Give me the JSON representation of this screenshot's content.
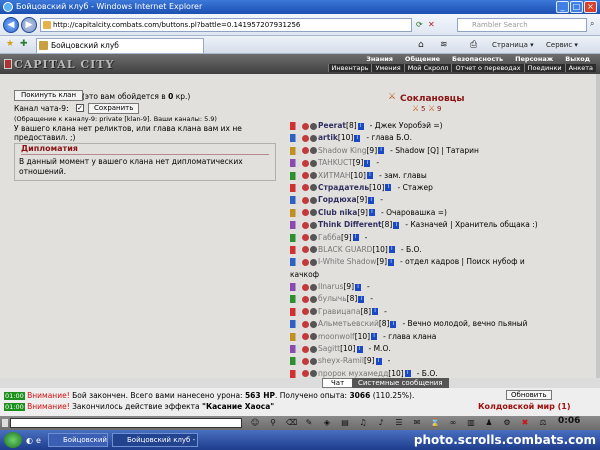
{
  "window": {
    "title": "Бойцовский клуб - Windows Internet Explorer"
  },
  "addressbar": {
    "url": "http://capitalcity.combats.com/buttons.pl?battle=0.141957207931256",
    "search_placeholder": "Rambler Search"
  },
  "tabbar": {
    "tab_title": "Бойцовский клуб",
    "page_label": "Страница",
    "service_label": "Сервис"
  },
  "game": {
    "logo": "CAPITAL CITY",
    "main_nav": [
      "Знания",
      "Общение",
      "Безопасность",
      "Персонаж",
      "Выход"
    ],
    "sub_nav": [
      "Инвентарь",
      "Умения",
      "Мой Скролл",
      "Отчет о переводах",
      "Поединки",
      "Анкета"
    ]
  },
  "clan": {
    "leave_button": "Покинуть клан",
    "leave_note_pre": "(это вам обойдется в ",
    "leave_note_amount": "0",
    "leave_note_post": " кр.)",
    "chat_channel_label": "Канал чата-9:",
    "save_button": "Сохранить",
    "channel_hint": "(Обращение к каналу-9: private [klan-9]. Ваши каналы: 5.9)",
    "relics_line1": "У вашего клана нет реликтов, или глава клана вам их не",
    "relics_line2": "предоставил. ;)",
    "diplomacy_title": "Дипломатия",
    "diplomacy_text": "В данный момент у вашего клана нет дипломатических отношений.",
    "allies_title": "Соклановцы",
    "online_count": "5",
    "total_count": "9"
  },
  "members": [
    {
      "name": "Peerat",
      "level": "[8]",
      "bold": true,
      "grey": false,
      "desc": "- Джек Уоробэй =)"
    },
    {
      "name": "artik",
      "level": "[10]",
      "bold": true,
      "grey": false,
      "desc": "- глава Б.О."
    },
    {
      "name": "Shadow King",
      "level": "[9]",
      "bold": false,
      "grey": true,
      "desc": "- Shadow [Q] | Татарин"
    },
    {
      "name": "TAHKUCT",
      "level": "[9]",
      "bold": false,
      "grey": true,
      "desc": "-"
    },
    {
      "name": "ХИТМАН",
      "level": "[10]",
      "bold": false,
      "grey": true,
      "desc": "- зам. главы"
    },
    {
      "name": "Страдатель",
      "level": "[10]",
      "bold": true,
      "grey": false,
      "desc": "- Стажер"
    },
    {
      "name": "Гордюха",
      "level": "[9]",
      "bold": true,
      "grey": false,
      "desc": "-"
    },
    {
      "name": "Club nika",
      "level": "[9]",
      "bold": true,
      "grey": false,
      "desc": "- Очаровашка =)"
    },
    {
      "name": "Think Different",
      "level": "[8]",
      "bold": true,
      "grey": false,
      "desc": "- Казначей | Хранитель общака :)"
    },
    {
      "name": "Габба",
      "level": "[9]",
      "bold": false,
      "grey": true,
      "desc": "-"
    },
    {
      "name": "BLACK GUARD",
      "level": "[10]",
      "bold": false,
      "grey": true,
      "desc": "- Б.О."
    },
    {
      "name": "I-White Shadow",
      "level": "[9]",
      "bold": false,
      "grey": true,
      "desc": "- отдел кадров | Поиск нубоф и"
    },
    {
      "name": "",
      "level": "",
      "bold": false,
      "grey": false,
      "desc": "качкоф"
    },
    {
      "name": "Ilnarus",
      "level": "[9]",
      "bold": false,
      "grey": true,
      "desc": "-"
    },
    {
      "name": "булычь",
      "level": "[8]",
      "bold": false,
      "grey": true,
      "desc": "-"
    },
    {
      "name": "Гравицапа",
      "level": "[8]",
      "bold": false,
      "grey": true,
      "desc": "-"
    },
    {
      "name": "Альметьевский",
      "level": "[8]",
      "bold": false,
      "grey": true,
      "desc": "- Вечно молодой, вечно пьяный"
    },
    {
      "name": "moonwolf",
      "level": "[10]",
      "bold": false,
      "grey": true,
      "desc": "- глава клана"
    },
    {
      "name": "Sagitt",
      "level": "[10]",
      "bold": false,
      "grey": true,
      "desc": "- М.О."
    },
    {
      "name": "sheyx-Ramil",
      "level": "[9]",
      "bold": false,
      "grey": true,
      "desc": "-"
    },
    {
      "name": "пророк мухамедд",
      "level": "[10]",
      "bold": false,
      "grey": true,
      "desc": "- Б.О."
    },
    {
      "name": "Рогач",
      "level": "[9]",
      "bold": false,
      "grey": true,
      "desc": "-"
    },
    {
      "name": "Дункан Маклауд",
      "level": "[9]",
      "bold": false,
      "grey": true,
      "desc": "- глава отдела кадров"
    },
    {
      "name": "Шайтанка",
      "level": "[9]",
      "bold": false,
      "grey": true,
      "desc": "- Торговый отдел | Леди клана"
    }
  ],
  "chat": {
    "tab_chat": "Чат",
    "tab_system": "Системные сообщения",
    "msg1_time": "01:00",
    "msg1_warn": "Внимание!",
    "msg1_text": " Бой закончен. Всего вами нанесено урона: ",
    "msg1_hp": "563 HP",
    "msg1_text2": ". Получено опыта: ",
    "msg1_exp": "3066",
    "msg1_text3": " (110.25%).",
    "msg2_time": "01:00",
    "msg2_warn": "Внимание!",
    "msg2_text": " Закончилось действие эффекта ",
    "msg2_effect": "\"Касание Хаоса\"",
    "refresh_button": "Обновить",
    "world": "Колдовской мир (1)",
    "clock": "0:06"
  },
  "taskbar": {
    "task1": "Бойцовский клуб - Wi...",
    "task2": "Бойцовский клуб - Wi...",
    "watermark": "photo.scrolls.combats.com"
  }
}
